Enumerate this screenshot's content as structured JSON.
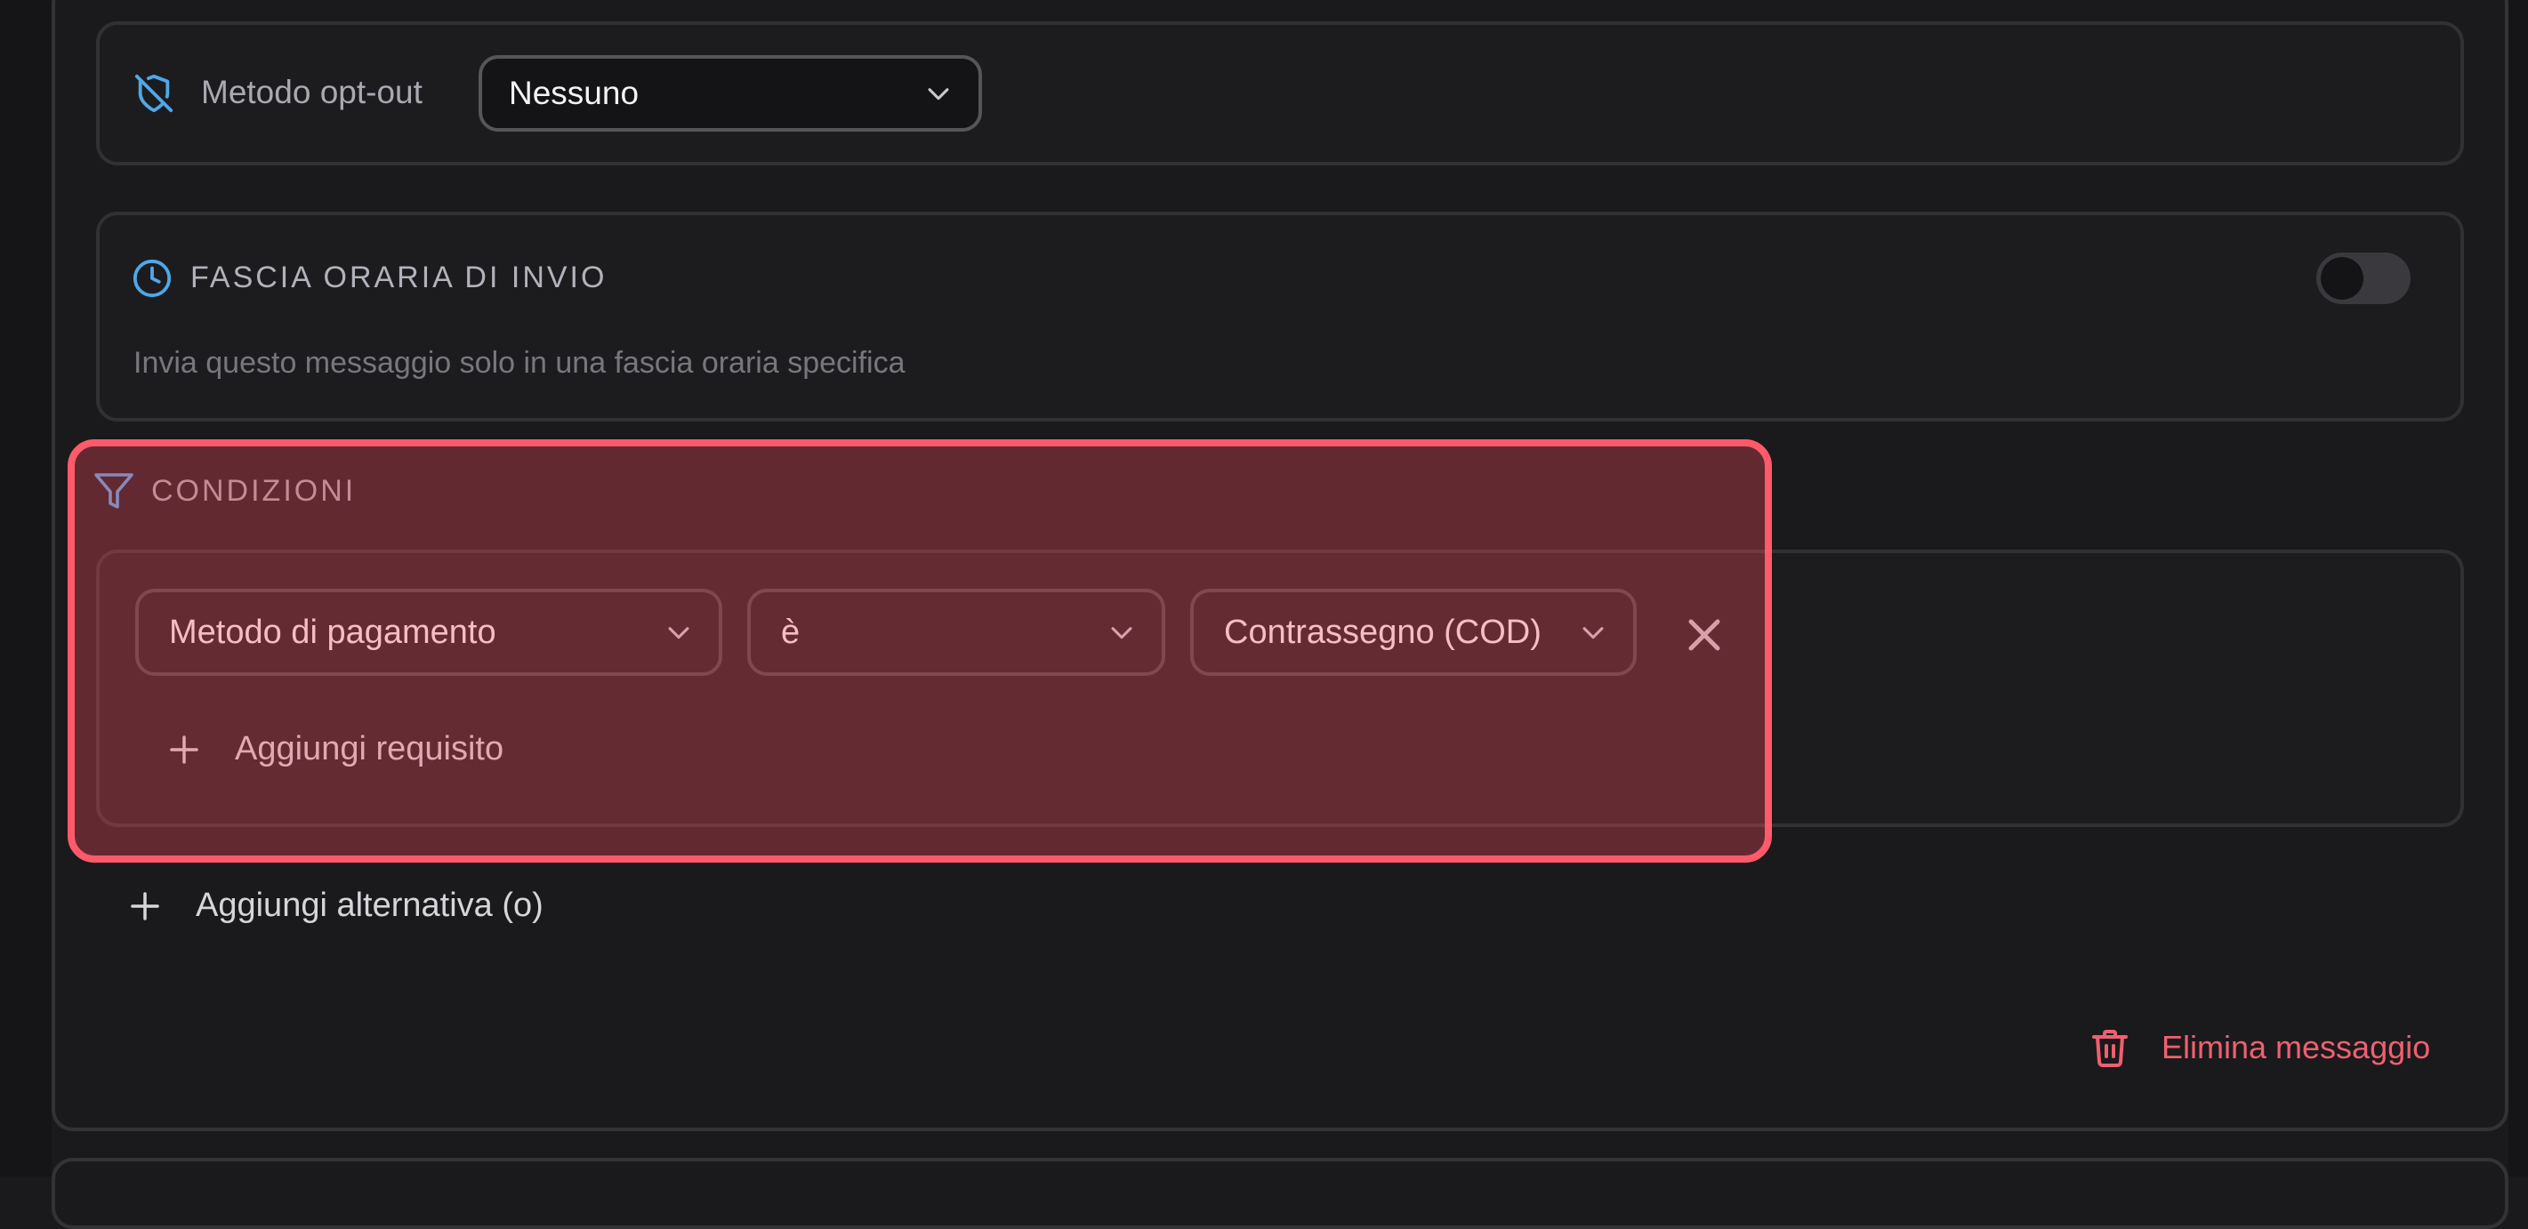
{
  "colors": {
    "background": "#1a1a1c",
    "accent_blue": "#4fa8e8",
    "danger": "#ef6070",
    "highlight": "#ff5a6a"
  },
  "optout": {
    "icon": "shield-off-icon",
    "label": "Metodo opt-out",
    "select_value": "Nessuno"
  },
  "time_window": {
    "icon": "clock-icon",
    "title": "FASCIA ORARIA DI INVIO",
    "description": "Invia questo messaggio solo in una fascia oraria specifica",
    "toggle_on": false
  },
  "conditions": {
    "icon": "filter-icon",
    "title": "CONDIZIONI",
    "rule": {
      "field": "Metodo di pagamento",
      "operator": "è",
      "value": "Contrassegno (COD)"
    },
    "add_requirement_label": "Aggiungi requisito",
    "add_alternative_label": "Aggiungi alternativa (o)"
  },
  "footer": {
    "delete_label": "Elimina messaggio",
    "delete_icon": "trash-icon"
  }
}
